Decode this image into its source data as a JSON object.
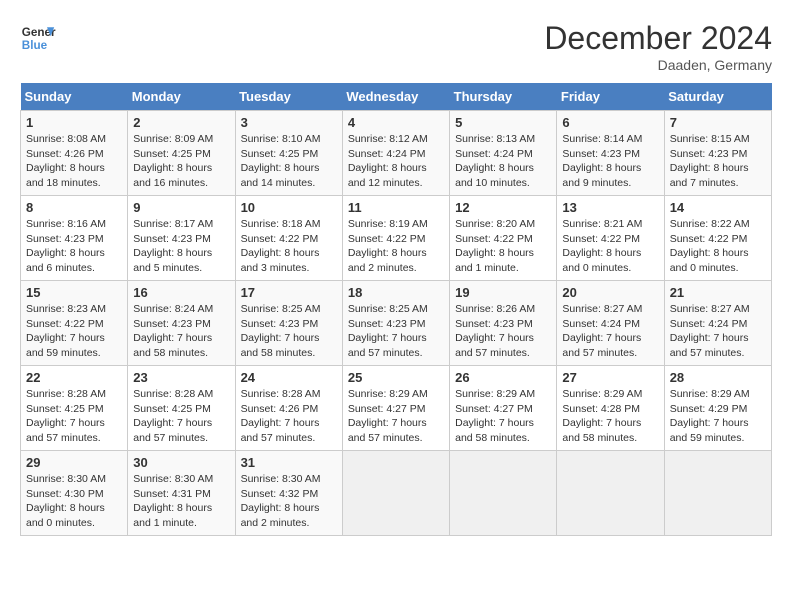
{
  "header": {
    "logo_line1": "General",
    "logo_line2": "Blue",
    "month": "December 2024",
    "location": "Daaden, Germany"
  },
  "days_of_week": [
    "Sunday",
    "Monday",
    "Tuesday",
    "Wednesday",
    "Thursday",
    "Friday",
    "Saturday"
  ],
  "weeks": [
    [
      {
        "day": 1,
        "info": "Sunrise: 8:08 AM\nSunset: 4:26 PM\nDaylight: 8 hours\nand 18 minutes."
      },
      {
        "day": 2,
        "info": "Sunrise: 8:09 AM\nSunset: 4:25 PM\nDaylight: 8 hours\nand 16 minutes."
      },
      {
        "day": 3,
        "info": "Sunrise: 8:10 AM\nSunset: 4:25 PM\nDaylight: 8 hours\nand 14 minutes."
      },
      {
        "day": 4,
        "info": "Sunrise: 8:12 AM\nSunset: 4:24 PM\nDaylight: 8 hours\nand 12 minutes."
      },
      {
        "day": 5,
        "info": "Sunrise: 8:13 AM\nSunset: 4:24 PM\nDaylight: 8 hours\nand 10 minutes."
      },
      {
        "day": 6,
        "info": "Sunrise: 8:14 AM\nSunset: 4:23 PM\nDaylight: 8 hours\nand 9 minutes."
      },
      {
        "day": 7,
        "info": "Sunrise: 8:15 AM\nSunset: 4:23 PM\nDaylight: 8 hours\nand 7 minutes."
      }
    ],
    [
      {
        "day": 8,
        "info": "Sunrise: 8:16 AM\nSunset: 4:23 PM\nDaylight: 8 hours\nand 6 minutes."
      },
      {
        "day": 9,
        "info": "Sunrise: 8:17 AM\nSunset: 4:23 PM\nDaylight: 8 hours\nand 5 minutes."
      },
      {
        "day": 10,
        "info": "Sunrise: 8:18 AM\nSunset: 4:22 PM\nDaylight: 8 hours\nand 3 minutes."
      },
      {
        "day": 11,
        "info": "Sunrise: 8:19 AM\nSunset: 4:22 PM\nDaylight: 8 hours\nand 2 minutes."
      },
      {
        "day": 12,
        "info": "Sunrise: 8:20 AM\nSunset: 4:22 PM\nDaylight: 8 hours\nand 1 minute."
      },
      {
        "day": 13,
        "info": "Sunrise: 8:21 AM\nSunset: 4:22 PM\nDaylight: 8 hours\nand 0 minutes."
      },
      {
        "day": 14,
        "info": "Sunrise: 8:22 AM\nSunset: 4:22 PM\nDaylight: 8 hours\nand 0 minutes."
      }
    ],
    [
      {
        "day": 15,
        "info": "Sunrise: 8:23 AM\nSunset: 4:22 PM\nDaylight: 7 hours\nand 59 minutes."
      },
      {
        "day": 16,
        "info": "Sunrise: 8:24 AM\nSunset: 4:23 PM\nDaylight: 7 hours\nand 58 minutes."
      },
      {
        "day": 17,
        "info": "Sunrise: 8:25 AM\nSunset: 4:23 PM\nDaylight: 7 hours\nand 58 minutes."
      },
      {
        "day": 18,
        "info": "Sunrise: 8:25 AM\nSunset: 4:23 PM\nDaylight: 7 hours\nand 57 minutes."
      },
      {
        "day": 19,
        "info": "Sunrise: 8:26 AM\nSunset: 4:23 PM\nDaylight: 7 hours\nand 57 minutes."
      },
      {
        "day": 20,
        "info": "Sunrise: 8:27 AM\nSunset: 4:24 PM\nDaylight: 7 hours\nand 57 minutes."
      },
      {
        "day": 21,
        "info": "Sunrise: 8:27 AM\nSunset: 4:24 PM\nDaylight: 7 hours\nand 57 minutes."
      }
    ],
    [
      {
        "day": 22,
        "info": "Sunrise: 8:28 AM\nSunset: 4:25 PM\nDaylight: 7 hours\nand 57 minutes."
      },
      {
        "day": 23,
        "info": "Sunrise: 8:28 AM\nSunset: 4:25 PM\nDaylight: 7 hours\nand 57 minutes."
      },
      {
        "day": 24,
        "info": "Sunrise: 8:28 AM\nSunset: 4:26 PM\nDaylight: 7 hours\nand 57 minutes."
      },
      {
        "day": 25,
        "info": "Sunrise: 8:29 AM\nSunset: 4:27 PM\nDaylight: 7 hours\nand 57 minutes."
      },
      {
        "day": 26,
        "info": "Sunrise: 8:29 AM\nSunset: 4:27 PM\nDaylight: 7 hours\nand 58 minutes."
      },
      {
        "day": 27,
        "info": "Sunrise: 8:29 AM\nSunset: 4:28 PM\nDaylight: 7 hours\nand 58 minutes."
      },
      {
        "day": 28,
        "info": "Sunrise: 8:29 AM\nSunset: 4:29 PM\nDaylight: 7 hours\nand 59 minutes."
      }
    ],
    [
      {
        "day": 29,
        "info": "Sunrise: 8:30 AM\nSunset: 4:30 PM\nDaylight: 8 hours\nand 0 minutes."
      },
      {
        "day": 30,
        "info": "Sunrise: 8:30 AM\nSunset: 4:31 PM\nDaylight: 8 hours\nand 1 minute."
      },
      {
        "day": 31,
        "info": "Sunrise: 8:30 AM\nSunset: 4:32 PM\nDaylight: 8 hours\nand 2 minutes."
      },
      null,
      null,
      null,
      null
    ]
  ]
}
